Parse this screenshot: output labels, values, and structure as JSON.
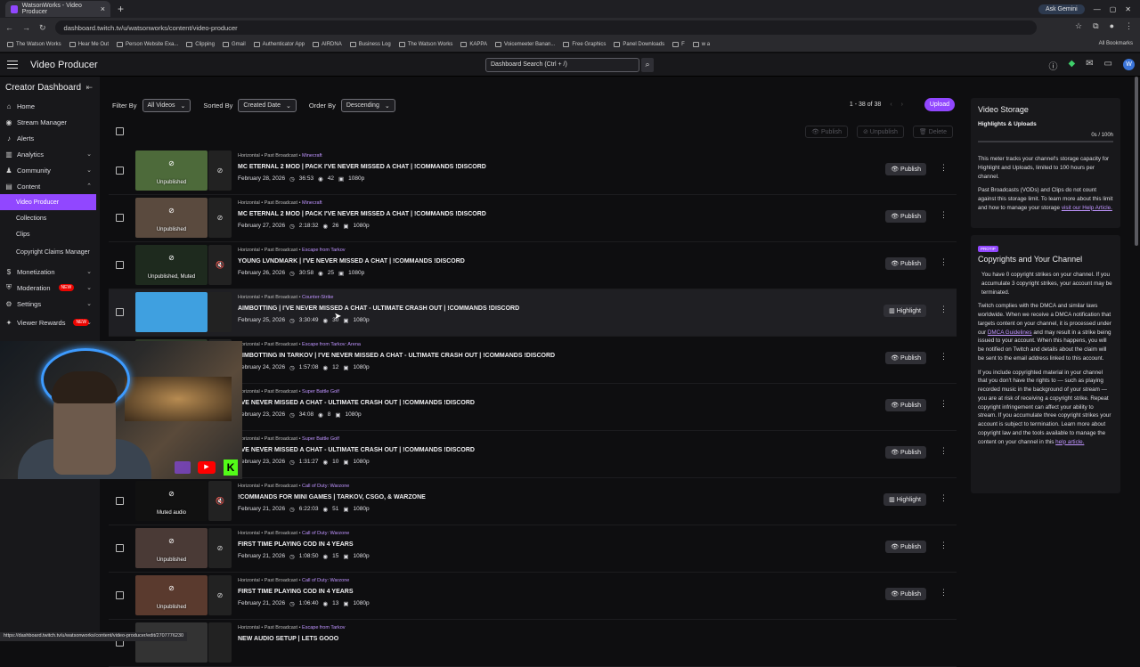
{
  "browser": {
    "tab_title": "WatsonWorks - Video Producer",
    "new_tab": "+",
    "ask_gemini": "Ask Gemini",
    "url": "dashboard.twitch.tv/u/watsonworks/content/video-producer",
    "bookmarks": [
      "The Watson Works",
      "Hear Me Out",
      "Person Website Exa...",
      "Clipping",
      "Gmail",
      "Authenticator App",
      "AIRDNA",
      "Business Log",
      "The Watson Works",
      "KAPPA",
      "Voicemeeter Banan...",
      "Free Graphics",
      "Panel Downloads",
      "F",
      "w a"
    ],
    "all_bookmarks": "All Bookmarks",
    "status_url": "https://dashboard.twitch.tv/u/watsonworks/content/video-producer/edit/2707776230"
  },
  "topbar": {
    "title": "Video Producer",
    "search_placeholder": "Dashboard Search (Ctrl + /)"
  },
  "sidebar": {
    "title": "Creator Dashboard",
    "items": [
      {
        "label": "Home",
        "icon": "⌂"
      },
      {
        "label": "Stream Manager",
        "icon": "◉"
      },
      {
        "label": "Alerts",
        "icon": "♪"
      },
      {
        "label": "Analytics",
        "icon": "▥",
        "chev": "⌄"
      },
      {
        "label": "Community",
        "icon": "♟",
        "chev": "⌄"
      },
      {
        "label": "Content",
        "icon": "▤",
        "chev": "⌃"
      }
    ],
    "content_sub": [
      "Video Producer",
      "Collections",
      "Clips",
      "Copyright Claims Manager"
    ],
    "items_after": [
      {
        "label": "Monetization",
        "icon": "$",
        "chev": "⌄"
      },
      {
        "label": "Moderation",
        "icon": "⛨",
        "chev": "⌄",
        "badge": "NEW"
      },
      {
        "label": "Settings",
        "icon": "⚙",
        "chev": "⌄"
      },
      {
        "label": "Viewer Rewards",
        "icon": "✦",
        "chev": "⌄",
        "badge": "NEW"
      }
    ]
  },
  "filters": {
    "filter_by": "Filter By",
    "filter_value": "All Videos",
    "sorted_by": "Sorted By",
    "sorted_value": "Created Date",
    "order_by": "Order By",
    "order_value": "Descending",
    "pager": "1 - 38 of 38",
    "upload": "Upload"
  },
  "bulk": {
    "publish": "Publish",
    "unpublish": "Unpublish",
    "delete": "Delete"
  },
  "videos": [
    {
      "meta": "Horizontal • Past Broadcast •",
      "game": "Minecraft",
      "title": "MC ETERNAL 2 MOD | PACK I'VE NEVER MISSED A CHAT | !COMMANDS !DISCORD",
      "date": "February 28, 2026",
      "duration": "36:53",
      "views": "42",
      "res": "1080p",
      "state": "Unpublished",
      "action": "Publish",
      "thumb": "#4d6a3a"
    },
    {
      "meta": "Horizontal • Past Broadcast •",
      "game": "Minecraft",
      "title": "MC ETERNAL 2 MOD | PACK I'VE NEVER MISSED A CHAT | !COMMANDS !DISCORD",
      "date": "February 27, 2026",
      "duration": "2:18:32",
      "views": "26",
      "res": "1080p",
      "state": "Unpublished",
      "action": "Publish",
      "thumb": "#5a4a3e"
    },
    {
      "meta": "Horizontal • Past Broadcast •",
      "game": "Escape from Tarkov",
      "title": "YOUNG LVNDMARK | I'VE NEVER MISSED A CHAT | !COMMANDS !DISCORD",
      "date": "February 26, 2026",
      "duration": "30:58",
      "views": "25",
      "res": "1080p",
      "state": "Unpublished, Muted",
      "action": "Publish",
      "thumb": "#1e2a1e"
    },
    {
      "meta": "Horizontal • Past Broadcast •",
      "game": "Counter-Strike",
      "title": "AIMBOTTING | I'VE NEVER MISSED A CHAT - ULTIMATE CRASH OUT | !COMMANDS !DISCORD",
      "date": "February 25, 2026",
      "duration": "3:30:49",
      "views": "30",
      "res": "1080p",
      "state": "",
      "action": "Highlight",
      "thumb": "#3fa0e0"
    },
    {
      "meta": "Horizontal • Past Broadcast •",
      "game": "Escape from Tarkov: Arena",
      "title": "AIMBOTTING IN TARKOV | I'VE NEVER MISSED A CHAT - ULTIMATE CRASH OUT | !COMMANDS !DISCORD",
      "date": "February 24, 2026",
      "duration": "1:57:08",
      "views": "12",
      "res": "1080p",
      "state": "",
      "action": "Publish",
      "thumb": "#2e3a2a"
    },
    {
      "meta": "Horizontal • Past Broadcast •",
      "game": "Super Battle Golf",
      "title": "I'VE NEVER MISSED A CHAT - ULTIMATE CRASH OUT | !COMMANDS !DISCORD",
      "date": "February 23, 2026",
      "duration": "34:08",
      "views": "8",
      "res": "1080p",
      "state": "",
      "action": "Publish",
      "thumb": "#333"
    },
    {
      "meta": "Horizontal • Past Broadcast •",
      "game": "Super Battle Golf",
      "title": "I'VE NEVER MISSED A CHAT - ULTIMATE CRASH OUT | !COMMANDS !DISCORD",
      "date": "February 23, 2026",
      "duration": "1:31:27",
      "views": "10",
      "res": "1080p",
      "state": "",
      "action": "Publish",
      "thumb": "#333"
    },
    {
      "meta": "Horizontal • Past Broadcast •",
      "game": "Call of Duty: Warzone",
      "title": "!COMMANDS FOR MINI GAMES | TARKOV, CSGO, & WARZONE",
      "date": "February 21, 2026",
      "duration": "6:22:03",
      "views": "51",
      "res": "1080p",
      "state": "Muted audio",
      "action": "Highlight",
      "thumb": "#111"
    },
    {
      "meta": "Horizontal • Past Broadcast •",
      "game": "Call of Duty: Warzone",
      "title": "FIRST TIME PLAYING COD IN 4 YEARS",
      "date": "February 21, 2026",
      "duration": "1:08:50",
      "views": "15",
      "res": "1080p",
      "state": "Unpublished",
      "action": "Publish",
      "thumb": "#4a3a36"
    },
    {
      "meta": "Horizontal • Past Broadcast •",
      "game": "Call of Duty: Warzone",
      "title": "FIRST TIME PLAYING COD IN 4 YEARS",
      "date": "February 21, 2026",
      "duration": "1:06:40",
      "views": "13",
      "res": "1080p",
      "state": "Unpublished",
      "action": "Publish",
      "thumb": "#5a3a2e"
    },
    {
      "meta": "Horizontal • Past Broadcast •",
      "game": "Escape from Tarkov",
      "title": "NEW AUDIO SETUP | LETS GOOO",
      "date": "",
      "duration": "",
      "views": "",
      "res": "",
      "state": "",
      "action": "",
      "thumb": "#333"
    }
  ],
  "storage": {
    "title": "Video Storage",
    "subtitle": "Highlights & Uploads",
    "meter": "0s / 100h",
    "text1": "This meter tracks your channel's storage capacity for Highlight and Uploads, limited to 100 hours per channel.",
    "text2": "Past Broadcasts (VODs) and Clips do not count against this storage limit. To learn more about this limit and how to manage your storage",
    "link": "visit our Help Article."
  },
  "copyright": {
    "protip": "PROTIP",
    "title": "Copyrights and Your Channel",
    "text1": "You have 0 copyright strikes on your channel. If you accumulate 3 copyright strikes, your account may be terminated.",
    "text2a": "Twitch complies with the DMCA and similar laws worldwide. When we receive a DMCA notification that targets content on your channel, it is processed under our",
    "link1": "DMCA Guidelines",
    "text2b": "and may result in a strike being issued to your account. When this happens, you will be notified on Twitch and details about the claim will be sent to the email address linked to this account.",
    "text3a": "If you include copyrighted material in your channel that you don't have the rights to — such as playing recorded music in the background of your stream — you are at risk of receiving a copyright strike. Repeat copyright infringement can affect your ability to stream. If you accumulate three copyright strikes your account is subject to termination. Learn more about copyright law and the tools available to manage the content on your channel in this",
    "link2": "help article."
  }
}
